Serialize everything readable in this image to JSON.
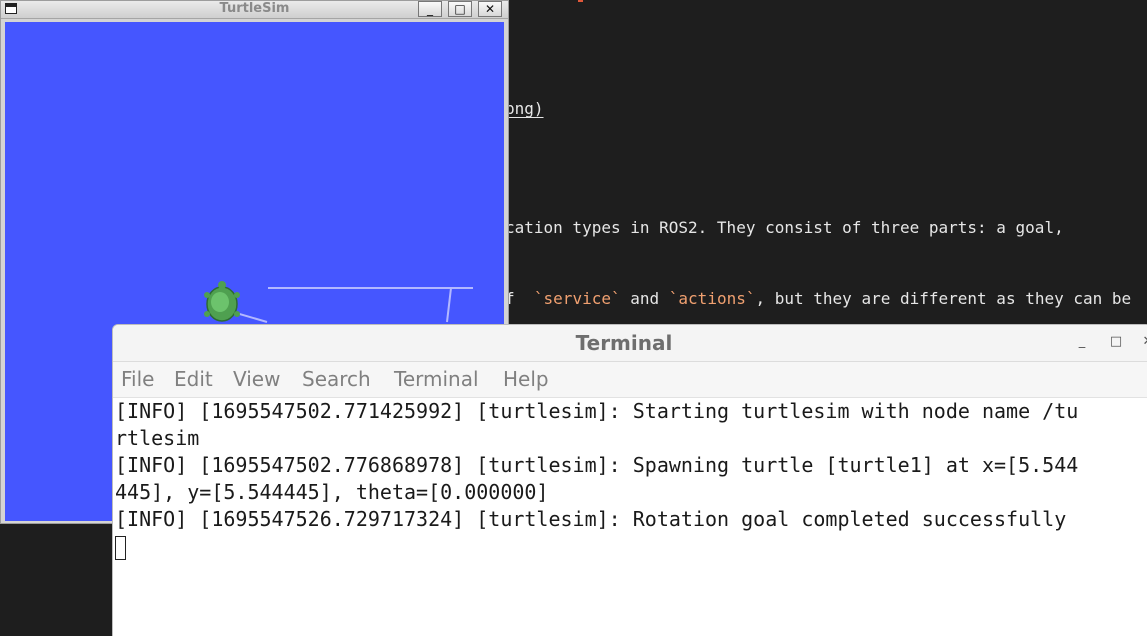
{
  "editor": {
    "line_png": "png)",
    "line_actions_intro": "cation types in ROS2. They consist of three parts: a goal,",
    "line_part_a": "f  ",
    "line_code_service": "`service`",
    "line_and": " and ",
    "line_code_actions": "`actions`",
    "line_part_b": ", but they are different as they can be"
  },
  "turtlesim": {
    "title": "TurtleSim",
    "minimize_glyph": "_",
    "maximize_glyph": "□",
    "close_glyph": "✕",
    "background_color": "#4556ff"
  },
  "terminal": {
    "title": "Terminal",
    "minimize_glyph": "_",
    "maximize_glyph": "□",
    "close_glyph": "✕",
    "menu": [
      "File",
      "Edit",
      "View",
      "Search",
      "Terminal",
      "Help"
    ],
    "lines": [
      "[INFO] [1695547502.771425992] [turtlesim]: Starting turtlesim with node name /tu",
      "rtlesim",
      "[INFO] [1695547502.776868978] [turtlesim]: Spawning turtle [turtle1] at x=[5.544",
      "445], y=[5.544445], theta=[0.000000]",
      "[INFO] [1695547526.729717324] [turtlesim]: Rotation goal completed successfully"
    ]
  }
}
